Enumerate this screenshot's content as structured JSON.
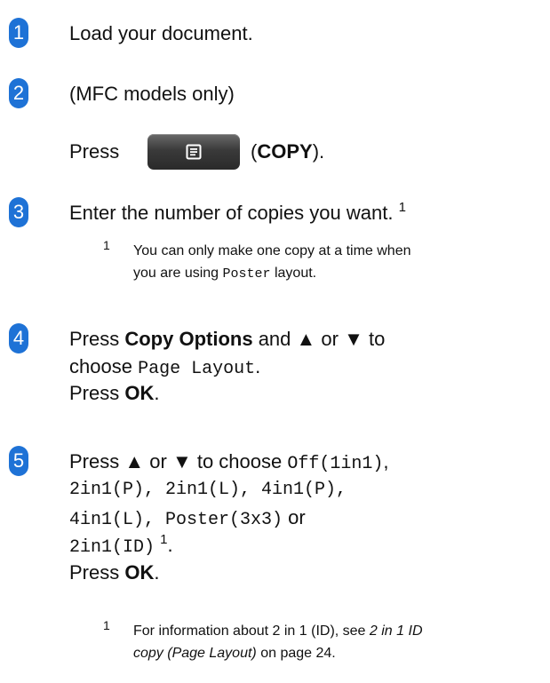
{
  "steps": [
    {
      "num": "1",
      "text": "Load your document."
    },
    {
      "num": "2",
      "line1": "(MFC models only)",
      "press": "Press",
      "copy_open": "(",
      "copy_label": "COPY",
      "copy_close": ")."
    },
    {
      "num": "3",
      "text": "Enter the number of copies you want.",
      "sup": "1"
    },
    {
      "num": "4",
      "l1_pre": "Press ",
      "l1_bold": "Copy Options",
      "l1_mid": " and ",
      "up": "▲",
      "or": " or ",
      "down": "▼",
      "l1_post": " to",
      "l2_pre": "choose ",
      "l2_mono": "Page Layout",
      "l2_post": ".",
      "l3_pre": "Press ",
      "l3_bold": "OK",
      "l3_post": "."
    },
    {
      "num": "5",
      "l1_pre": "Press ",
      "up": "▲",
      "or": " or ",
      "down": "▼",
      "l1_mid": " to choose ",
      "l1_mono": "Off(1in1)",
      "l1_post": ",",
      "l2_mono": "2in1(P), 2in1(L), 4in1(P),",
      "l3_mono": "4in1(L), Poster(3x3)",
      "l3_or": " or",
      "l4_mono": "2in1(ID)",
      "l4_sup": "1",
      "l4_post": ".",
      "l5_pre": "Press ",
      "l5_bold": "OK",
      "l5_post": "."
    }
  ],
  "notes": [
    {
      "num": "1",
      "line1": "You can only make one copy at a time when",
      "line2_pre": "you are using ",
      "line2_mono": "Poster",
      "line2_post": " layout."
    },
    {
      "num": "1",
      "line1_pre": "For information about 2 in 1 (ID), see ",
      "line1_it": "2 in 1 ID",
      "line2_it": "copy (Page Layout)",
      "line2_post": " on page 24."
    }
  ],
  "colors": {
    "step_badge": "#1e72d6",
    "copy_button": "#3a3a3a"
  },
  "icons": {
    "copy_button": "copy-document-icon"
  }
}
